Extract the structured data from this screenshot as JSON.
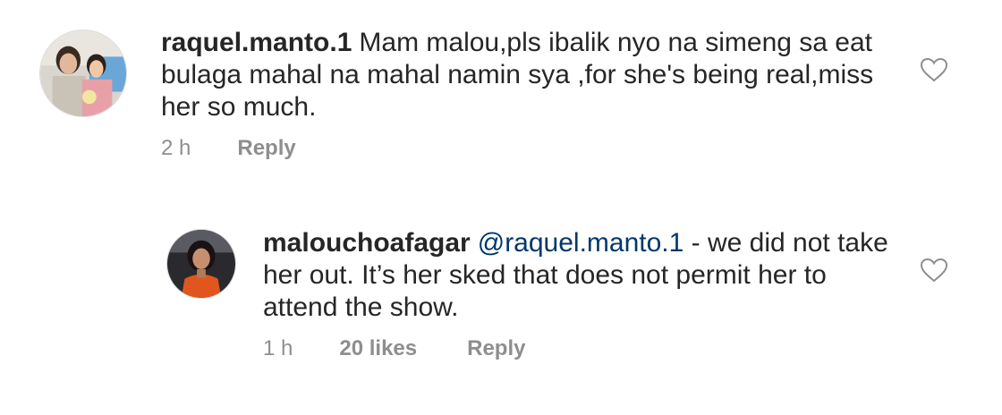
{
  "comments": [
    {
      "username": "raquel.manto.1",
      "text": "Mam malou,pls ibalik nyo na simeng sa eat bulaga mahal na mahal namin sya ,for she's being real,miss her so much.",
      "time": "2 h",
      "reply_label": "Reply",
      "avatar_icon": "avatar-photo-woman-and-child"
    }
  ],
  "replies": [
    {
      "username": "malouchoafagar",
      "mention": "@raquel.manto.1",
      "text": " - we did not take her out. It’s her sked that does not permit her to attend the show.",
      "time": "1 h",
      "likes": "20 likes",
      "reply_label": "Reply",
      "avatar_icon": "avatar-photo-woman-orange"
    }
  ],
  "icons": {
    "like": "heart-outline-icon"
  },
  "colors": {
    "text": "#262626",
    "meta": "#8e8e8e",
    "mention": "#00376b",
    "heart_stroke": "#8e8e8e"
  }
}
